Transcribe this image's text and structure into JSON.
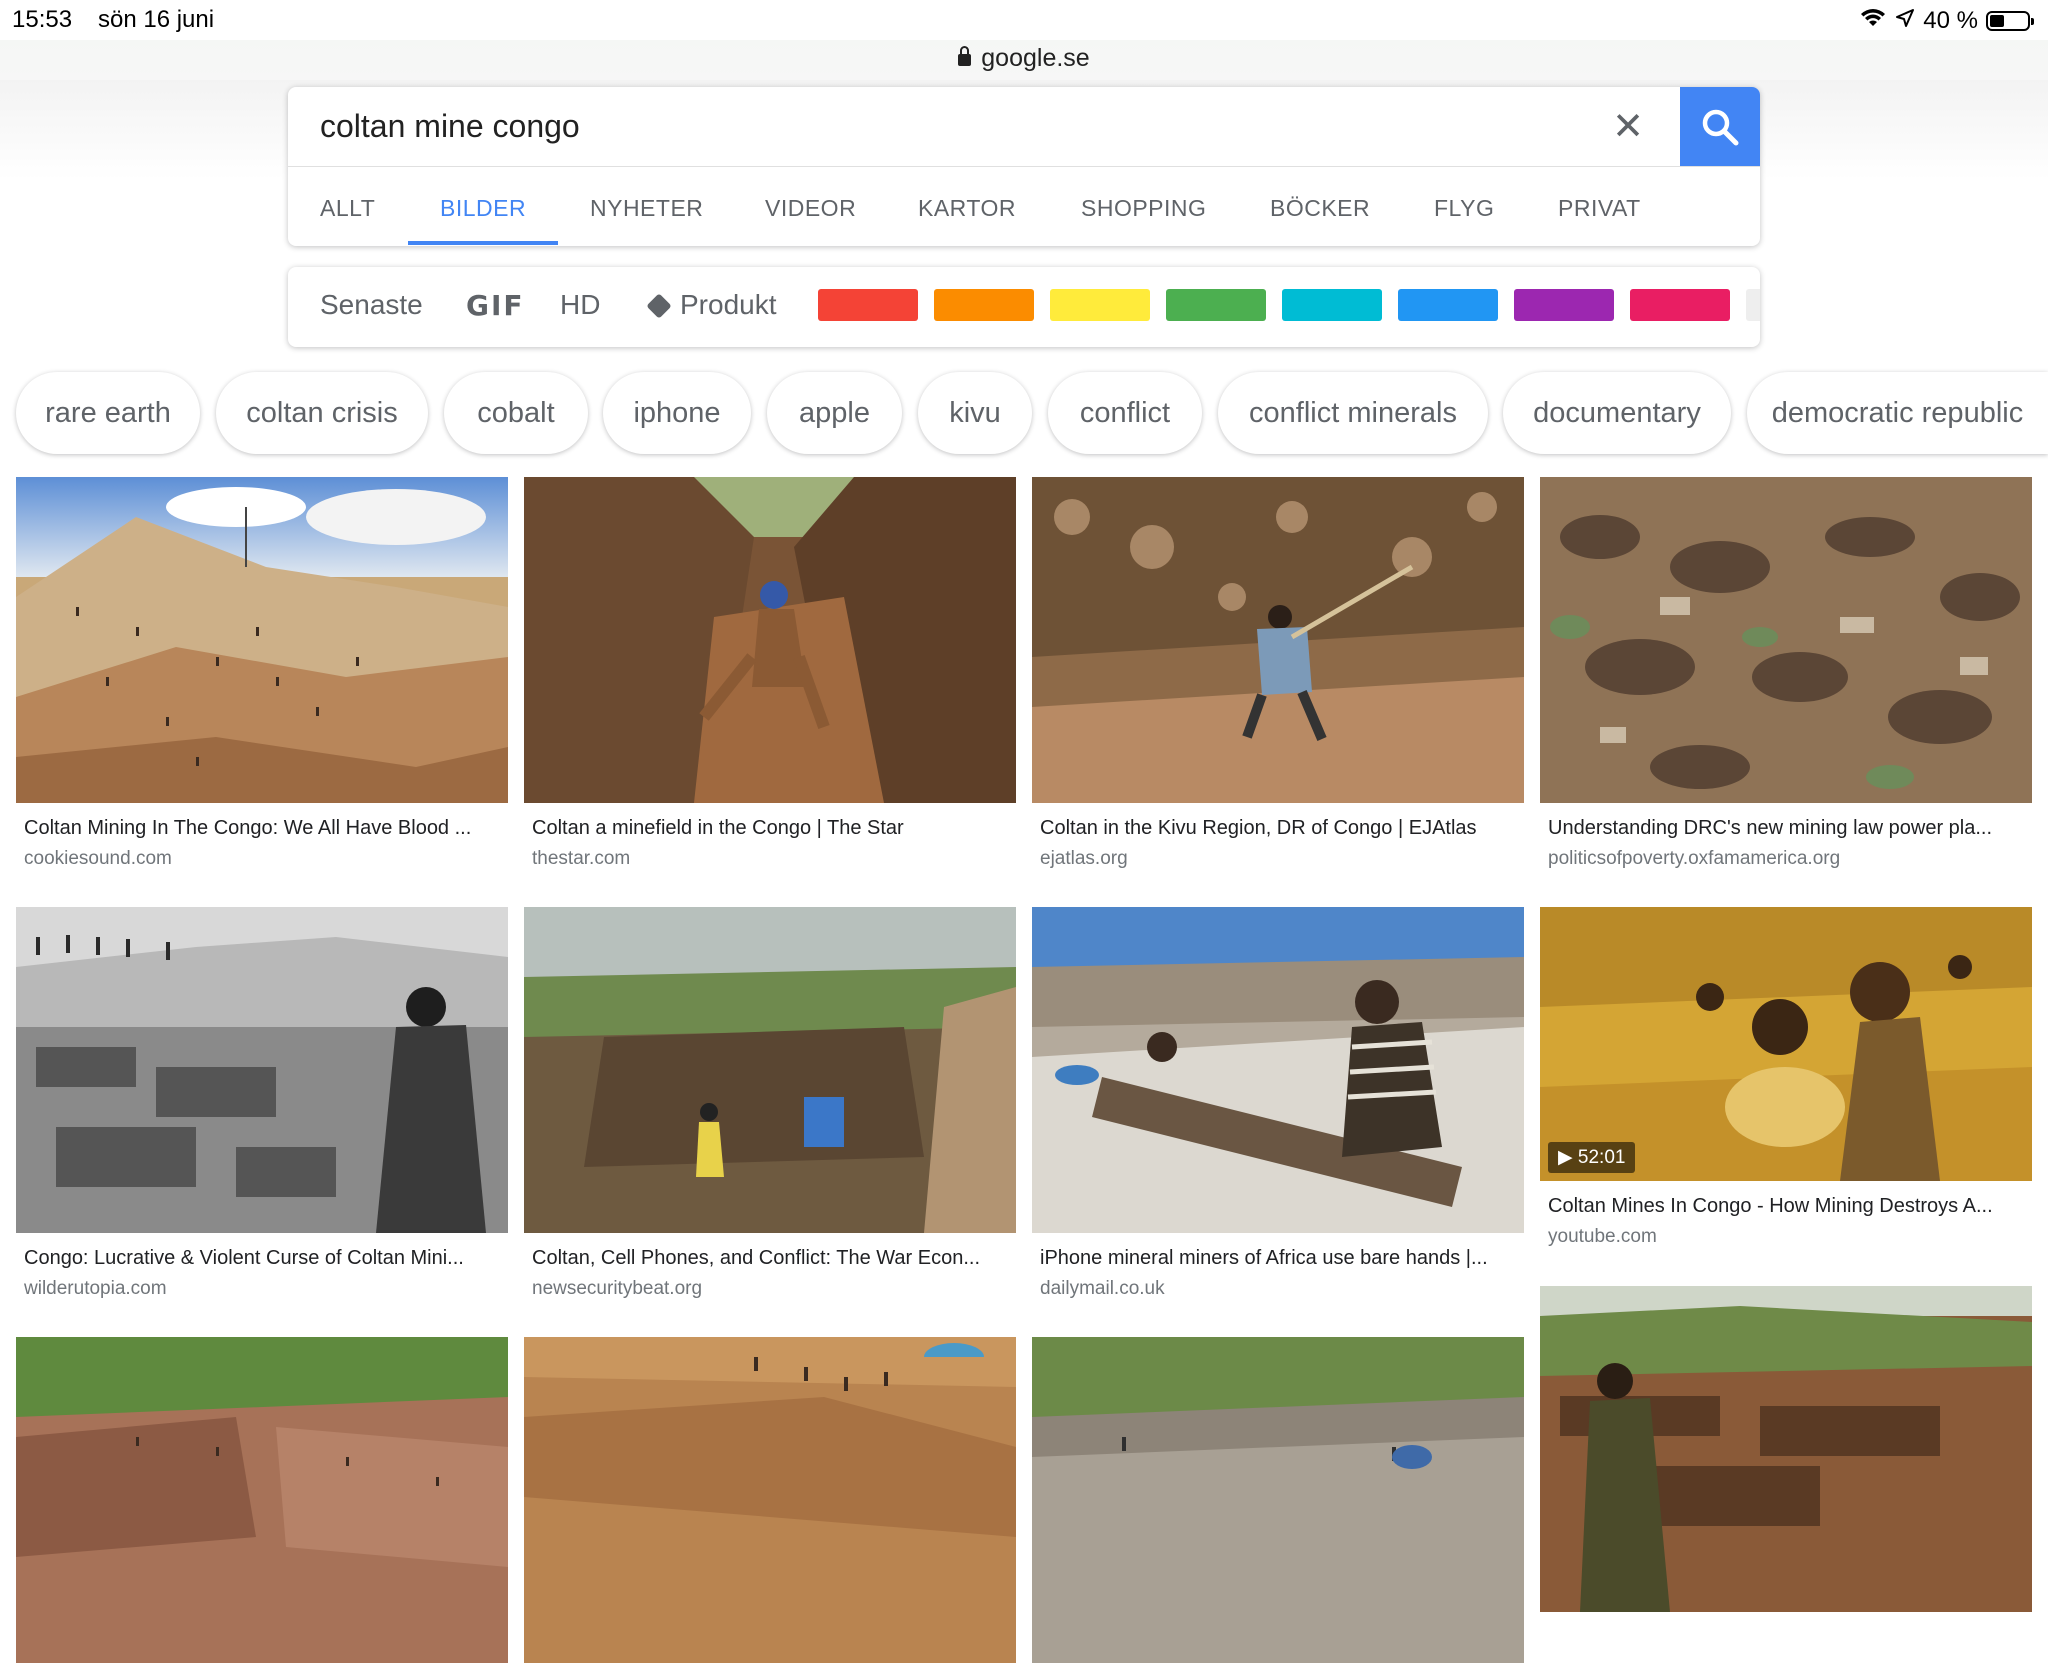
{
  "status_bar": {
    "time": "15:53",
    "date": "sön 16 juni",
    "battery_text": "40 %",
    "battery_level": 0.4
  },
  "browser": {
    "url": "google.se"
  },
  "search": {
    "query": "coltan mine congo",
    "clear_label": "✕"
  },
  "tabs": [
    {
      "label": "ALLT",
      "active": false
    },
    {
      "label": "BILDER",
      "active": true
    },
    {
      "label": "NYHETER",
      "active": false
    },
    {
      "label": "VIDEOR",
      "active": false
    },
    {
      "label": "KARTOR",
      "active": false
    },
    {
      "label": "SHOPPING",
      "active": false
    },
    {
      "label": "BÖCKER",
      "active": false
    },
    {
      "label": "FLYG",
      "active": false
    },
    {
      "label": "PRIVAT",
      "active": false
    }
  ],
  "filters": {
    "recent": "Senaste",
    "gif": "GIF",
    "hd": "HD",
    "product": "Produkt",
    "colors": [
      "#f44336",
      "#fb8c00",
      "#ffeb3b",
      "#4caf50",
      "#00bcd4",
      "#2196f3",
      "#9c27b0",
      "#e91e63"
    ]
  },
  "chips": [
    "rare earth",
    "coltan crisis",
    "cobalt",
    "iphone",
    "apple",
    "kivu",
    "conflict",
    "conflict minerals",
    "documentary",
    "democratic republic"
  ],
  "results": [
    {
      "title": "Coltan Mining In The Congo: We All Have Blood ...",
      "domain": "cookiesound.com"
    },
    {
      "title": "Coltan a minefield in the Congo | The Star",
      "domain": "thestar.com"
    },
    {
      "title": "Coltan in the Kivu Region, DR of Congo | EJAtlas",
      "domain": "ejatlas.org"
    },
    {
      "title": "Understanding DRC's new mining law power pla...",
      "domain": "politicsofpoverty.oxfamamerica.org"
    },
    {
      "title": "Congo: Lucrative & Violent Curse of Coltan Mini...",
      "domain": "wilderutopia.com"
    },
    {
      "title": "Coltan, Cell Phones, and Conflict: The War Econ...",
      "domain": "newsecuritybeat.org"
    },
    {
      "title": "iPhone mineral miners of Africa use bare hands |...",
      "domain": "dailymail.co.uk"
    },
    {
      "title": "Coltan Mines In Congo - How Mining Destroys A...",
      "domain": "youtube.com",
      "video_duration": "52:01"
    }
  ]
}
